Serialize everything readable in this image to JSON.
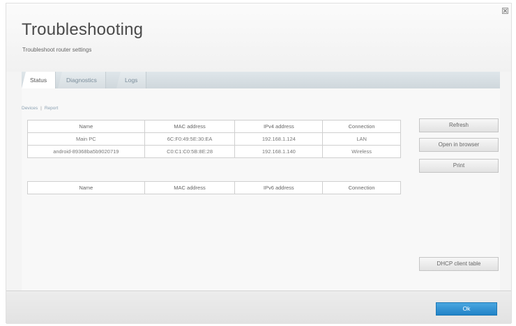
{
  "window": {
    "title": "Troubleshooting",
    "subtitle": "Troubleshoot router settings"
  },
  "tabs": [
    {
      "label": "Status"
    },
    {
      "label": "Diagnostics"
    },
    {
      "label": "Logs"
    }
  ],
  "links": {
    "devices": "Devices",
    "separator": "|",
    "report": "Report"
  },
  "ipv4_table": {
    "headers": [
      "Name",
      "MAC address",
      "IPv4 address",
      "Connection"
    ],
    "rows": [
      [
        "Main PC",
        "6C:F0:49:5E:30:EA",
        "192.168.1.124",
        "LAN"
      ],
      [
        "android-89368ba5b9020719",
        "C0:C1:C0:5B:8E:28",
        "192.168.1.140",
        "Wireless"
      ]
    ]
  },
  "ipv6_table": {
    "headers": [
      "Name",
      "MAC address",
      "IPv6 address",
      "Connection"
    ]
  },
  "buttons": {
    "refresh": "Refresh",
    "open_in_browser": "Open in browser",
    "print": "Print",
    "dhcp_client_table": "DHCP client table",
    "ok": "Ok"
  }
}
